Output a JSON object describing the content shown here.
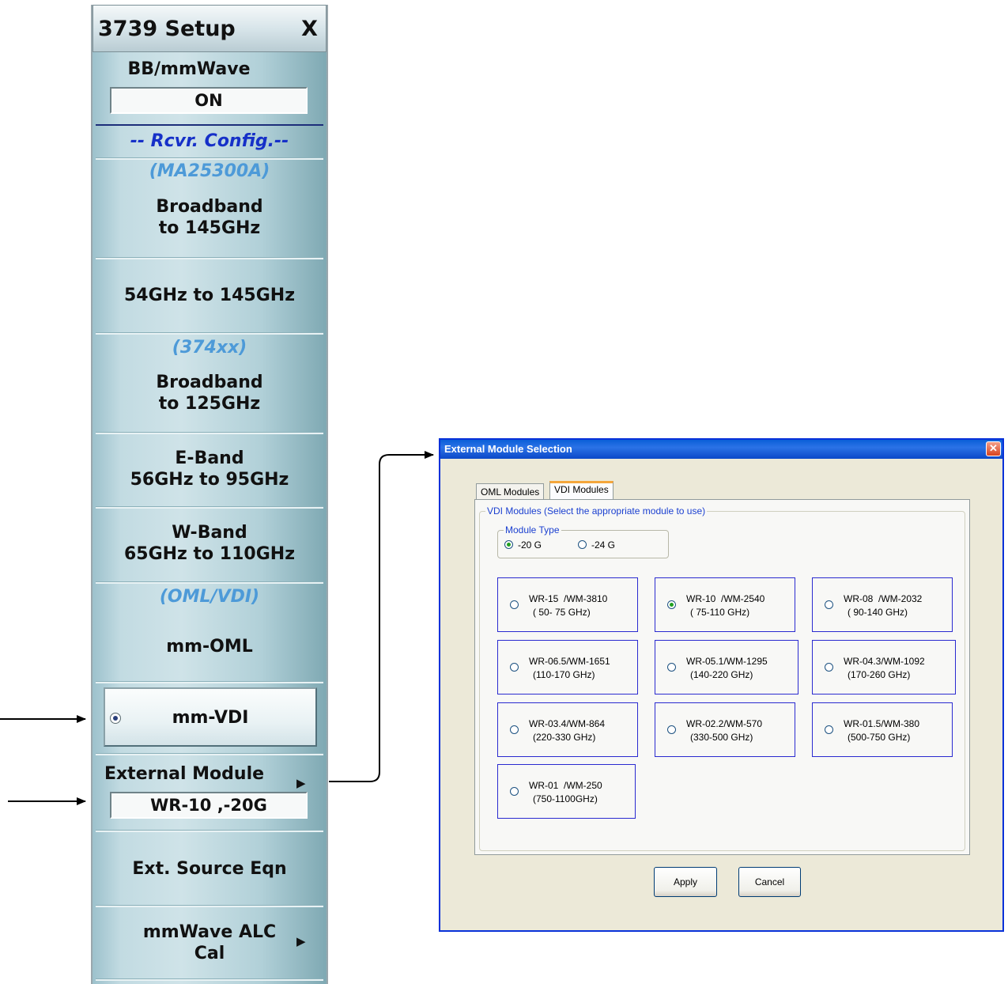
{
  "menu": {
    "title": "3739 Setup",
    "close_label": "X",
    "bb_mmwave_label": "BB/mmWave",
    "bb_mmwave_value": "ON",
    "rcvr_config": "-- Rcvr. Config.--",
    "ma25300a_header": "(MA25300A)",
    "broadband_145_line1": "Broadband",
    "broadband_145_line2": "to 145GHz",
    "band_54_145": "54GHz to 145GHz",
    "header_374xx": "(374xx)",
    "broadband_125_line1": "Broadband",
    "broadband_125_line2": "to 125GHz",
    "eband_line1": "E-Band",
    "eband_line2": "56GHz to 95GHz",
    "wband_line1": "W-Band",
    "wband_line2": "65GHz to 110GHz",
    "oml_vdi_header": "(OML/VDI)",
    "mm_oml": "mm-OML",
    "mm_vdi": "mm-VDI",
    "external_module_label": "External Module",
    "external_module_value": "WR-10 ,-20G",
    "ext_source_eqn": "Ext.  Source Eqn",
    "alc_cal_line1": "mmWave ALC",
    "alc_cal_line2": "Cal",
    "submenu_glyph": "▶"
  },
  "dialog": {
    "title": "External Module Selection",
    "close_glyph": "✕",
    "tabs": [
      {
        "label": "OML Modules",
        "active": false
      },
      {
        "label": "VDI Modules",
        "active": true
      }
    ],
    "group_title": "VDI Modules (Select the appropriate module to use)",
    "module_type_title": "Module Type",
    "module_types": [
      {
        "label": "-20 G",
        "selected": true
      },
      {
        "label": "-24 G",
        "selected": false
      }
    ],
    "modules": [
      {
        "line1": "WR-15  /WM-3810",
        "line2": "( 50- 75 GHz)",
        "selected": false
      },
      {
        "line1": "WR-10  /WM-2540",
        "line2": "( 75-110 GHz)",
        "selected": true
      },
      {
        "line1": "WR-08  /WM-2032",
        "line2": "( 90-140 GHz)",
        "selected": false
      },
      {
        "line1": "WR-06.5/WM-1651",
        "line2": "(110-170 GHz)",
        "selected": false
      },
      {
        "line1": "WR-05.1/WM-1295",
        "line2": "(140-220 GHz)",
        "selected": false
      },
      {
        "line1": "WR-04.3/WM-1092",
        "line2": "(170-260 GHz)",
        "selected": false
      },
      {
        "line1": "WR-03.4/WM-864",
        "line2": "(220-330 GHz)",
        "selected": false
      },
      {
        "line1": "WR-02.2/WM-570",
        "line2": "(330-500 GHz)",
        "selected": false
      },
      {
        "line1": "WR-01.5/WM-380",
        "line2": "(500-750 GHz)",
        "selected": false
      },
      {
        "line1": "WR-01  /WM-250",
        "line2": "(750-1100GHz)",
        "selected": false
      }
    ],
    "apply_label": "Apply",
    "cancel_label": "Cancel"
  },
  "colors": {
    "dialog_caption": "#0b48c8",
    "module_border": "#2a2ad0",
    "group_title": "#1a3fd0",
    "menu_header_light": "#4d9ad8",
    "menu_header_dark": "#1630c8"
  }
}
